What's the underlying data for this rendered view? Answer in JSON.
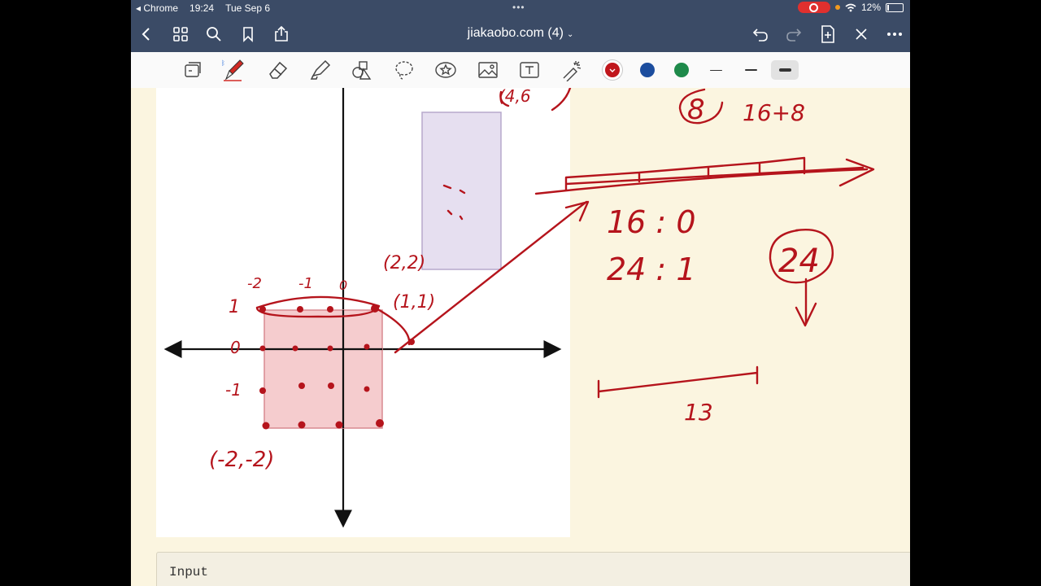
{
  "status_bar": {
    "back_app": "◂ Chrome",
    "time": "19:24",
    "date": "Tue Sep 6",
    "battery": "12%"
  },
  "nav": {
    "doc_title": "jiakaobo.com (4)",
    "title_chevron": "⌄"
  },
  "toolbar": {
    "colors": [
      "#c0161c",
      "#1c4d9e",
      "#1e8a4a"
    ],
    "strokes": [
      "thin",
      "medium",
      "thick"
    ],
    "selected_color": "#c0161c",
    "selected_stroke": "thick"
  },
  "input_box": {
    "label": "Input"
  },
  "handwriting": {
    "corner_a": "(2,2)",
    "corner_b": "(1,1)",
    "corner_c": "(-2,-2)",
    "top_partial": "(4,6",
    "circled_left": "8",
    "expr": "16+8",
    "ratio_1": "16 : 0",
    "ratio_2": "24 : 1",
    "circled_right": "24",
    "segment_label": "13",
    "tick_neg2": "-2",
    "tick_neg1": "-1",
    "tick_0": "0",
    "tick_1": "1",
    "row_0": "0",
    "row_neg1": "-1"
  }
}
